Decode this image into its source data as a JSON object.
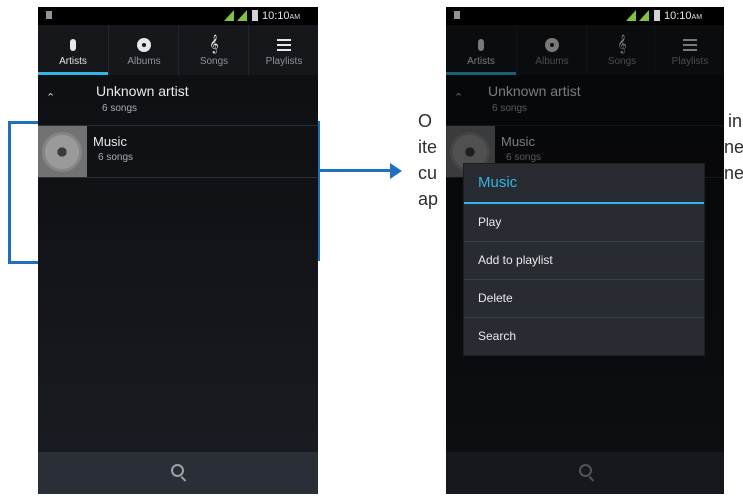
{
  "status_bar": {
    "time": "10:10",
    "ampm": "AM"
  },
  "tabs": [
    {
      "label": "Artists",
      "icon": "microphone-icon"
    },
    {
      "label": "Albums",
      "icon": "disc-icon"
    },
    {
      "label": "Songs",
      "icon": "treble-clef-icon"
    },
    {
      "label": "Playlists",
      "icon": "list-icon"
    }
  ],
  "active_tab": "Artists",
  "artist_group": {
    "name": "Unknown artist",
    "count": "6 songs",
    "expanded": true
  },
  "album": {
    "name": "Music",
    "count": "6 songs"
  },
  "context_menu": {
    "title": "Music",
    "items": [
      "Play",
      "Add to playlist",
      "Delete",
      "Search"
    ]
  },
  "callout_fragments": [
    "O",
    "in",
    "ite",
    "ne",
    "cu",
    "ne",
    "ap"
  ],
  "colors": {
    "accent": "#33b5e5",
    "annotation": "#1f6fbf",
    "signal": "#7fc341"
  }
}
